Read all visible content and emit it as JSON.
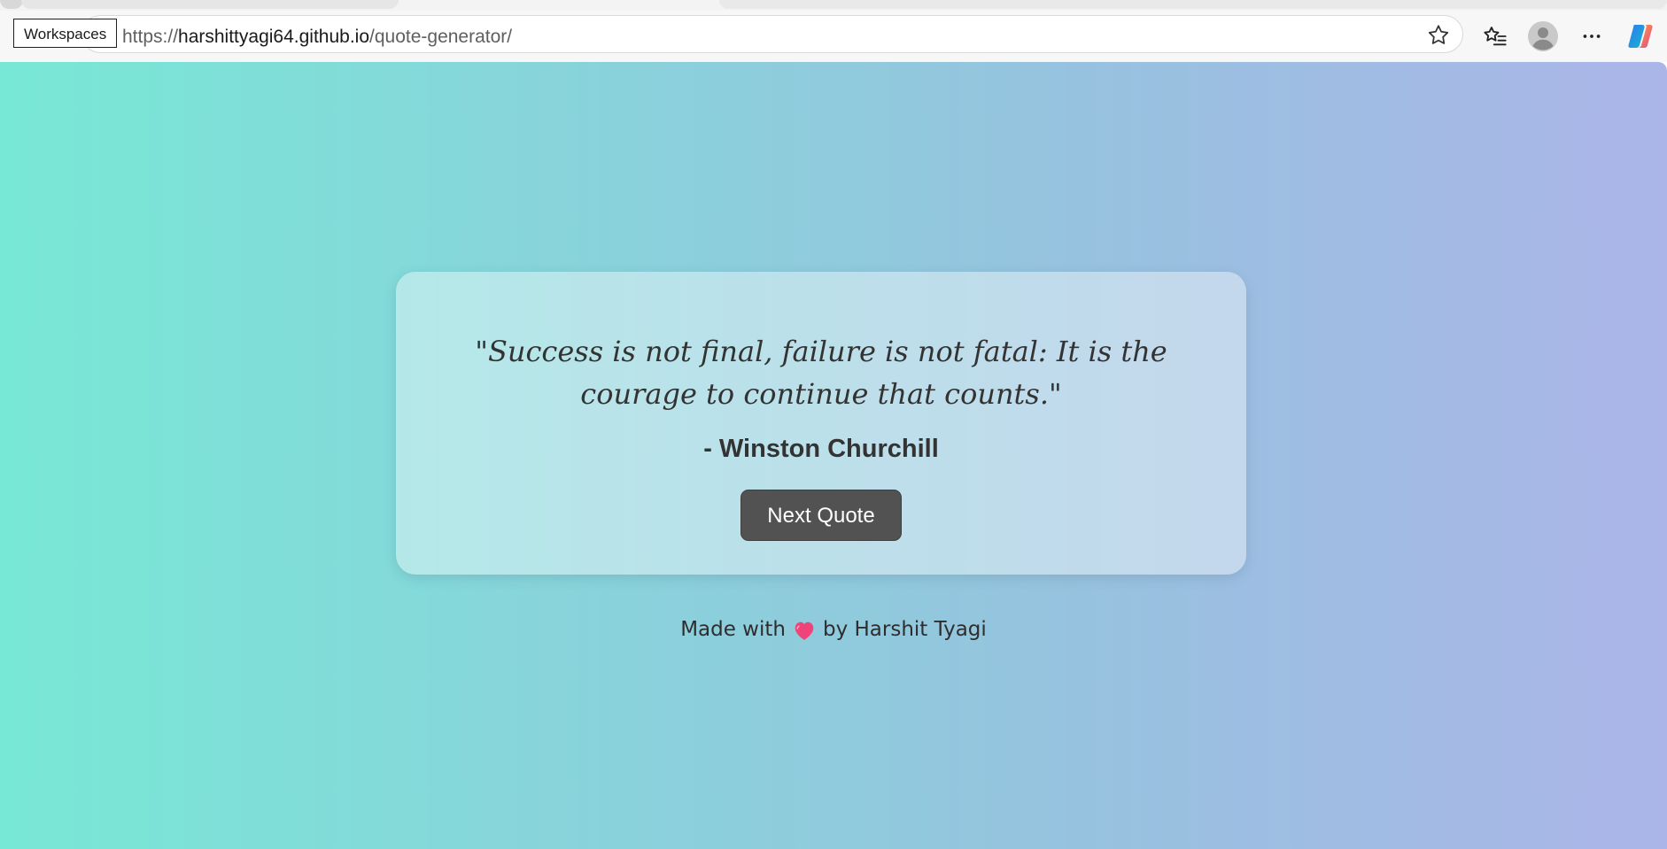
{
  "browser": {
    "workspaces_label": "Workspaces",
    "url_scheme": "https://",
    "url_host": "harshittyagi64.github.io",
    "url_path": "/quote-generator/",
    "icons": {
      "favorite": "star-icon",
      "favorites_list": "favorites-list-icon",
      "profile": "profile-avatar-icon",
      "more": "more-options-icon",
      "copilot": "copilot-icon"
    }
  },
  "card": {
    "quote": "\"Success is not final, failure is not fatal: It is the courage to continue that counts.\"",
    "author": "- Winston Churchill",
    "next_button_label": "Next Quote"
  },
  "footer": {
    "prefix": "Made with",
    "suffix": "by Harshit Tyagi",
    "icon": "heart-icon"
  },
  "colors": {
    "gradient_start": "#78e8d6",
    "gradient_end": "#abb5e8",
    "button_bg": "#525252",
    "heart": "#f0437a"
  }
}
